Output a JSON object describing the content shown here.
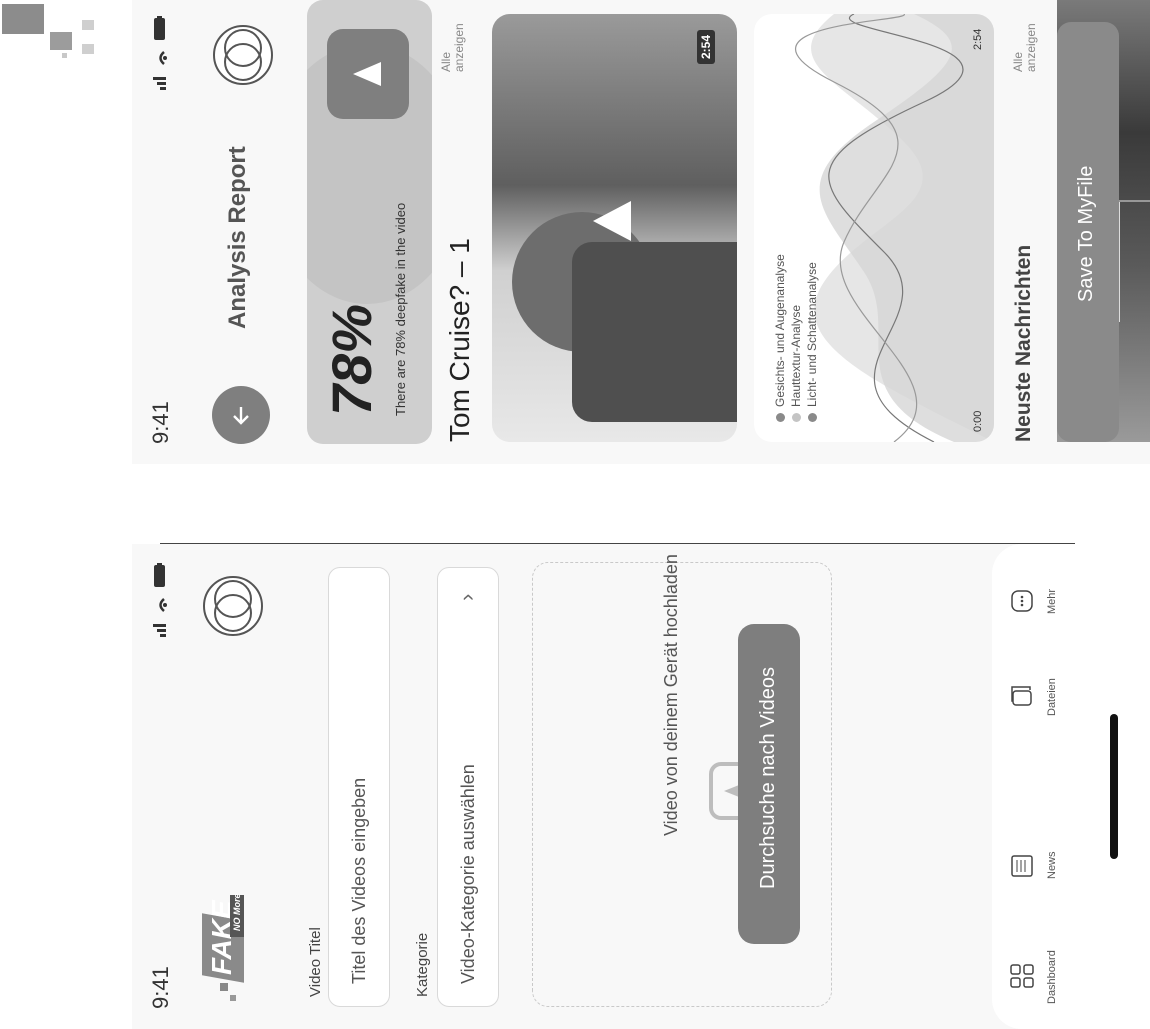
{
  "upload_screen": {
    "status_time": "9:41",
    "logo": {
      "word": "FAKE",
      "sub": "NO More"
    },
    "video_title_label": "Video Titel",
    "video_title_placeholder": "Titel des Videos eingeben",
    "category_label": "Kategorie",
    "category_placeholder": "Video-Kategorie auswählen",
    "upload_text": "Video von deinem Gerät hochladen",
    "browse_button": "Durchsuche nach Videos",
    "tabs": [
      {
        "label": "Dashboard",
        "icon": "grid-icon"
      },
      {
        "label": "News",
        "icon": "newspaper-icon"
      },
      {
        "label": "Dateien",
        "icon": "files-icon"
      },
      {
        "label": "Mehr",
        "icon": "more-dots-icon"
      }
    ]
  },
  "report_screen": {
    "status_time": "9:41",
    "title": "Analysis Report",
    "percent": "78%",
    "percent_desc": "There are 78% deepfake in the video",
    "see_all": "Alle anzeigen",
    "video_title": "Tom Cruise? – 1",
    "video_duration": "2:54",
    "legend": [
      {
        "label": "Gesichts- und Augenanalyse",
        "color": "#8a8a8a"
      },
      {
        "label": "Hauttextur-Analyse",
        "color": "#c4c4c4"
      },
      {
        "label": "Licht- und Schattenanalyse",
        "color": "#8a8a8a"
      }
    ],
    "axis_start": "0:00",
    "axis_end": "2:54",
    "news_title": "Neuste Nachrichten",
    "news_see_all": "Alle anzeigen",
    "save_button": "Save To MyFile"
  },
  "colors": {
    "accent": "#8a8a8a",
    "report_card": "#cfcfcf",
    "border": "#d9d9d9"
  }
}
